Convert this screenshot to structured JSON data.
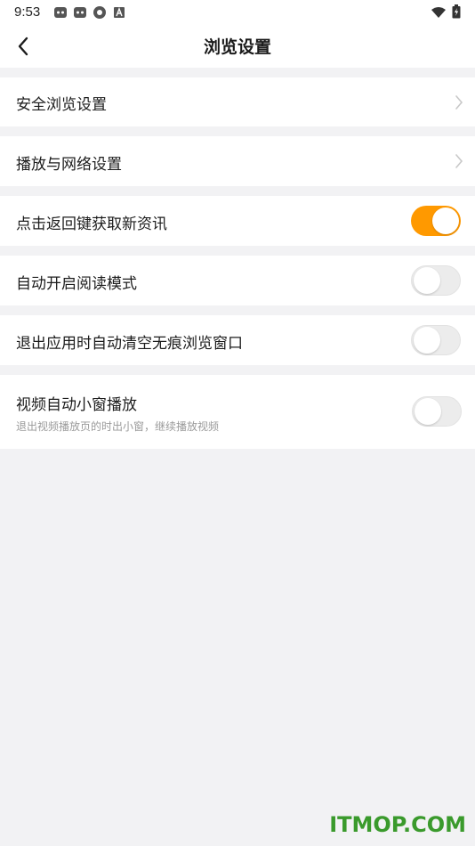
{
  "status_bar": {
    "time": "9:53",
    "left_icons": [
      "cat-app-icon",
      "cat-app-icon",
      "aperture-icon",
      "a-box-icon"
    ],
    "right_icons": [
      "wifi-icon",
      "battery-charging-icon"
    ]
  },
  "nav": {
    "title": "浏览设置",
    "back_icon": "back-arrow-icon"
  },
  "settings": {
    "safe_browsing": {
      "label": "安全浏览设置"
    },
    "playback_network": {
      "label": "播放与网络设置"
    },
    "back_key_news": {
      "label": "点击返回键获取新资讯",
      "enabled": true
    },
    "auto_reading_mode": {
      "label": "自动开启阅读模式",
      "enabled": false
    },
    "clear_incognito": {
      "label": "退出应用时自动清空无痕浏览窗口",
      "enabled": false
    },
    "auto_mini_window": {
      "label": "视频自动小窗播放",
      "description": "退出视频播放页的时出小窗，继续播放视频",
      "enabled": false
    }
  },
  "colors": {
    "accent": "#ff9900",
    "background": "#f2f2f4",
    "watermark": "#3a9a2c"
  },
  "watermark": "ITMOP.COM"
}
